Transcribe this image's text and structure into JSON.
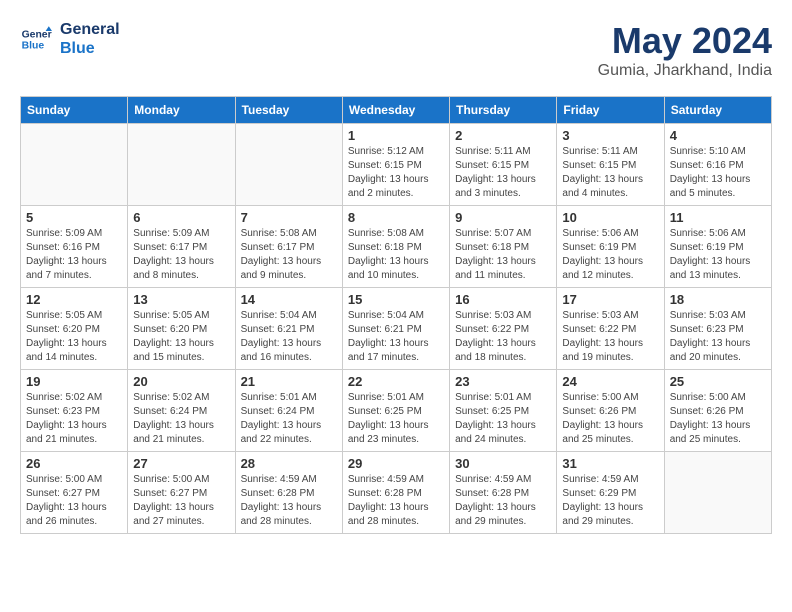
{
  "logo": {
    "line1": "General",
    "line2": "Blue"
  },
  "header": {
    "month": "May 2024",
    "location": "Gumia, Jharkhand, India"
  },
  "weekdays": [
    "Sunday",
    "Monday",
    "Tuesday",
    "Wednesday",
    "Thursday",
    "Friday",
    "Saturday"
  ],
  "weeks": [
    [
      {
        "day": "",
        "info": ""
      },
      {
        "day": "",
        "info": ""
      },
      {
        "day": "",
        "info": ""
      },
      {
        "day": "1",
        "info": "Sunrise: 5:12 AM\nSunset: 6:15 PM\nDaylight: 13 hours and 2 minutes."
      },
      {
        "day": "2",
        "info": "Sunrise: 5:11 AM\nSunset: 6:15 PM\nDaylight: 13 hours and 3 minutes."
      },
      {
        "day": "3",
        "info": "Sunrise: 5:11 AM\nSunset: 6:15 PM\nDaylight: 13 hours and 4 minutes."
      },
      {
        "day": "4",
        "info": "Sunrise: 5:10 AM\nSunset: 6:16 PM\nDaylight: 13 hours and 5 minutes."
      }
    ],
    [
      {
        "day": "5",
        "info": "Sunrise: 5:09 AM\nSunset: 6:16 PM\nDaylight: 13 hours and 7 minutes."
      },
      {
        "day": "6",
        "info": "Sunrise: 5:09 AM\nSunset: 6:17 PM\nDaylight: 13 hours and 8 minutes."
      },
      {
        "day": "7",
        "info": "Sunrise: 5:08 AM\nSunset: 6:17 PM\nDaylight: 13 hours and 9 minutes."
      },
      {
        "day": "8",
        "info": "Sunrise: 5:08 AM\nSunset: 6:18 PM\nDaylight: 13 hours and 10 minutes."
      },
      {
        "day": "9",
        "info": "Sunrise: 5:07 AM\nSunset: 6:18 PM\nDaylight: 13 hours and 11 minutes."
      },
      {
        "day": "10",
        "info": "Sunrise: 5:06 AM\nSunset: 6:19 PM\nDaylight: 13 hours and 12 minutes."
      },
      {
        "day": "11",
        "info": "Sunrise: 5:06 AM\nSunset: 6:19 PM\nDaylight: 13 hours and 13 minutes."
      }
    ],
    [
      {
        "day": "12",
        "info": "Sunrise: 5:05 AM\nSunset: 6:20 PM\nDaylight: 13 hours and 14 minutes."
      },
      {
        "day": "13",
        "info": "Sunrise: 5:05 AM\nSunset: 6:20 PM\nDaylight: 13 hours and 15 minutes."
      },
      {
        "day": "14",
        "info": "Sunrise: 5:04 AM\nSunset: 6:21 PM\nDaylight: 13 hours and 16 minutes."
      },
      {
        "day": "15",
        "info": "Sunrise: 5:04 AM\nSunset: 6:21 PM\nDaylight: 13 hours and 17 minutes."
      },
      {
        "day": "16",
        "info": "Sunrise: 5:03 AM\nSunset: 6:22 PM\nDaylight: 13 hours and 18 minutes."
      },
      {
        "day": "17",
        "info": "Sunrise: 5:03 AM\nSunset: 6:22 PM\nDaylight: 13 hours and 19 minutes."
      },
      {
        "day": "18",
        "info": "Sunrise: 5:03 AM\nSunset: 6:23 PM\nDaylight: 13 hours and 20 minutes."
      }
    ],
    [
      {
        "day": "19",
        "info": "Sunrise: 5:02 AM\nSunset: 6:23 PM\nDaylight: 13 hours and 21 minutes."
      },
      {
        "day": "20",
        "info": "Sunrise: 5:02 AM\nSunset: 6:24 PM\nDaylight: 13 hours and 21 minutes."
      },
      {
        "day": "21",
        "info": "Sunrise: 5:01 AM\nSunset: 6:24 PM\nDaylight: 13 hours and 22 minutes."
      },
      {
        "day": "22",
        "info": "Sunrise: 5:01 AM\nSunset: 6:25 PM\nDaylight: 13 hours and 23 minutes."
      },
      {
        "day": "23",
        "info": "Sunrise: 5:01 AM\nSunset: 6:25 PM\nDaylight: 13 hours and 24 minutes."
      },
      {
        "day": "24",
        "info": "Sunrise: 5:00 AM\nSunset: 6:26 PM\nDaylight: 13 hours and 25 minutes."
      },
      {
        "day": "25",
        "info": "Sunrise: 5:00 AM\nSunset: 6:26 PM\nDaylight: 13 hours and 25 minutes."
      }
    ],
    [
      {
        "day": "26",
        "info": "Sunrise: 5:00 AM\nSunset: 6:27 PM\nDaylight: 13 hours and 26 minutes."
      },
      {
        "day": "27",
        "info": "Sunrise: 5:00 AM\nSunset: 6:27 PM\nDaylight: 13 hours and 27 minutes."
      },
      {
        "day": "28",
        "info": "Sunrise: 4:59 AM\nSunset: 6:28 PM\nDaylight: 13 hours and 28 minutes."
      },
      {
        "day": "29",
        "info": "Sunrise: 4:59 AM\nSunset: 6:28 PM\nDaylight: 13 hours and 28 minutes."
      },
      {
        "day": "30",
        "info": "Sunrise: 4:59 AM\nSunset: 6:28 PM\nDaylight: 13 hours and 29 minutes."
      },
      {
        "day": "31",
        "info": "Sunrise: 4:59 AM\nSunset: 6:29 PM\nDaylight: 13 hours and 29 minutes."
      },
      {
        "day": "",
        "info": ""
      }
    ]
  ]
}
